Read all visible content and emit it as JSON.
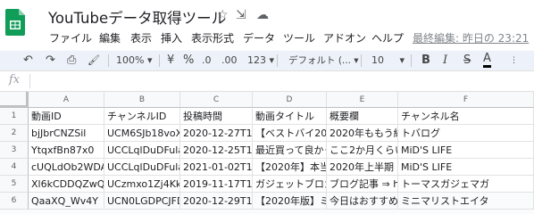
{
  "app": {
    "title": "YouTubeデータ取得ツール",
    "last_edit": "最終編集: 昨日の 23:21",
    "brand_color": "#0f9d58"
  },
  "title_icons": [
    {
      "name": "star-icon",
      "glyph": "☆"
    },
    {
      "name": "move-to-folder-icon",
      "glyph": "⇲"
    },
    {
      "name": "cloud-status-icon",
      "glyph": "☁"
    }
  ],
  "menu": [
    "ファイル",
    "編集",
    "表示",
    "挿入",
    "表示形式",
    "データ",
    "ツール",
    "アドオン",
    "ヘルプ"
  ],
  "toolbar": {
    "undo": "↶",
    "redo": "↷",
    "print": "⎙",
    "paint_format": "🖌",
    "zoom": "100%",
    "currency": "¥",
    "percent": "%",
    "decimal_decrease": ".0",
    "decimal_increase": ".00",
    "number_format": "123",
    "font": "デフォルト (...",
    "font_size": "10",
    "bold": "B",
    "italic": "I",
    "strikethrough": "S",
    "text_color": "A",
    "dropdown": "▾"
  },
  "formula_bar": {
    "label": "fx",
    "value": ""
  },
  "sheet": {
    "columns": [
      "A",
      "B",
      "C",
      "D",
      "E",
      "F"
    ],
    "row_numbers": [
      "1",
      "2",
      "3",
      "4",
      "5",
      "6"
    ],
    "rows": [
      [
        "動画ID",
        "チャンネルID",
        "投稿時間",
        "動画タイトル",
        "概要欄",
        "チャンネル名"
      ],
      [
        "bjJbrCNZSil",
        "UCM6SJb18voX",
        "2020-12-27T11:5",
        "【ベストバイ202",
        "2020年ももう終",
        "トバログ"
      ],
      [
        "YtqxfBn87x0",
        "UCCLqlDuDFula",
        "2020-12-25T10:",
        "最近買って良かっ",
        "ここ2か月くらい",
        "MiD'S LIFE"
      ],
      [
        "cUQLdOb2WDA",
        "UCCLqlDuDFula",
        "2021-01-02T10:",
        "【2020年】本当に",
        "2020年上半期・下",
        "MiD'S LIFE"
      ],
      [
        "Xl6kCDDQZwQ",
        "UCzmxo1Zj4KkK",
        "2019-11-17T13:",
        "ガジェットブロガー",
        "ブログ記事 ⇒ ht",
        "トーマスガジェマガ"
      ],
      [
        "QaaXQ_Wv4Y",
        "UCN0LGDPCJFD",
        "2020-12-29T11:",
        "【2020年版】ミ",
        "今日はおすすめ",
        "ミニマリストエイタ"
      ]
    ]
  }
}
